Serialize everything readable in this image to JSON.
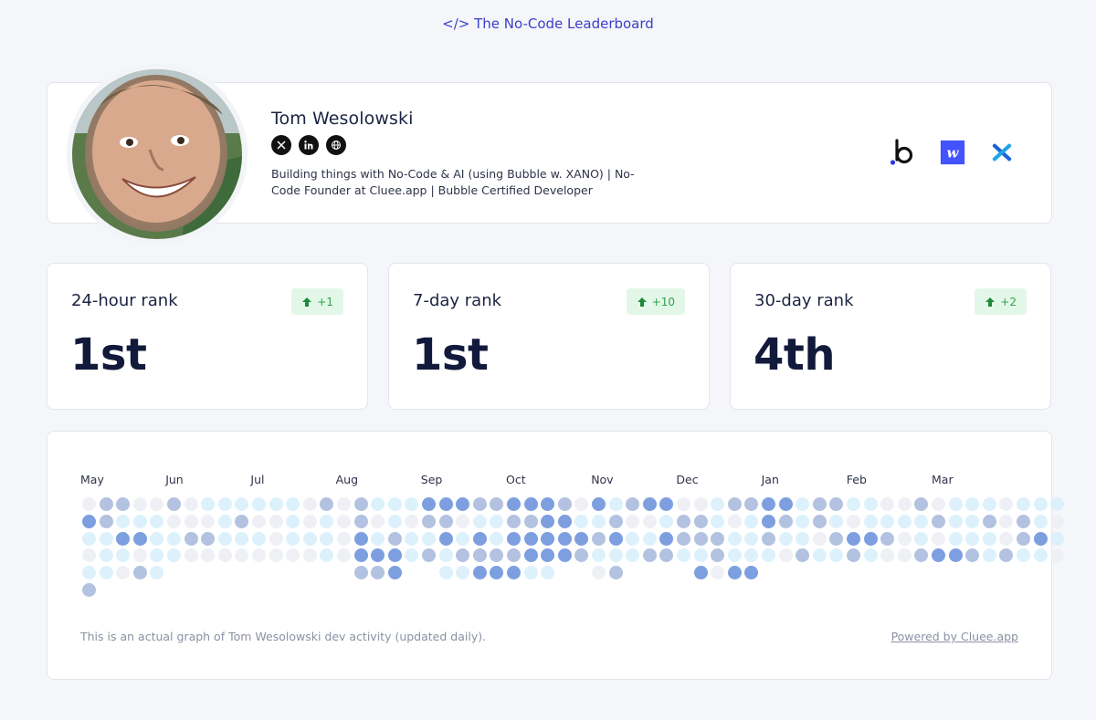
{
  "header": {
    "link_text": "</> The No-Code Leaderboard"
  },
  "profile": {
    "name": "Tom Wesolowski",
    "bio": "Building things with No-Code & AI (using Bubble w. XANO) | No-Code Founder at Cluee.app | Bubble Certified Developer",
    "socials": [
      "x-icon",
      "linkedin-icon",
      "globe-icon"
    ],
    "tools": [
      "bubble-logo",
      "webflow-logo",
      "xano-logo"
    ]
  },
  "ranks": [
    {
      "label": "24-hour rank",
      "change": "+1",
      "value": "1st"
    },
    {
      "label": "7-day rank",
      "change": "+10",
      "value": "1st"
    },
    {
      "label": "30-day rank",
      "change": "+2",
      "value": "4th"
    }
  ],
  "activity": {
    "months": [
      "May",
      "Jun",
      "Jul",
      "Aug",
      "Sep",
      "Oct",
      "Nov",
      "Dec",
      "Jan",
      "Feb",
      "Mar"
    ],
    "levels_colors": [
      "#eef0f5",
      "#dcf1fb",
      "#b3c2e0",
      "#7d9fe0"
    ],
    "weeks": [
      [
        0,
        3,
        1,
        0,
        1,
        2
      ],
      [
        2,
        2,
        1,
        1,
        1
      ],
      [
        2,
        1,
        3,
        1,
        0
      ],
      [
        0,
        1,
        3,
        0,
        2
      ],
      [
        0,
        1,
        1,
        1,
        1
      ],
      [
        2,
        0,
        1,
        1
      ],
      [
        0,
        0,
        2,
        0
      ],
      [
        1,
        0,
        2,
        0
      ],
      [
        1,
        1,
        1,
        0
      ],
      [
        1,
        2,
        1,
        0
      ],
      [
        1,
        0,
        1,
        0
      ],
      [
        1,
        0,
        0,
        0
      ],
      [
        1,
        1,
        1,
        0
      ],
      [
        0,
        0,
        1,
        0
      ],
      [
        2,
        1,
        1,
        1
      ],
      [
        0,
        0,
        0,
        0
      ],
      [
        2,
        2,
        3,
        3,
        2
      ],
      [
        1,
        0,
        1,
        3,
        2
      ],
      [
        1,
        1,
        2,
        3,
        3
      ],
      [
        1,
        0,
        1,
        1
      ],
      [
        3,
        2,
        1,
        2
      ],
      [
        3,
        2,
        3,
        1,
        1
      ],
      [
        3,
        0,
        1,
        2,
        1
      ],
      [
        2,
        1,
        3,
        2,
        3
      ],
      [
        2,
        1,
        1,
        2,
        3
      ],
      [
        3,
        2,
        3,
        2,
        3
      ],
      [
        3,
        2,
        3,
        3,
        1
      ],
      [
        3,
        3,
        3,
        3,
        1
      ],
      [
        2,
        3,
        3,
        3
      ],
      [
        0,
        1,
        3,
        2
      ],
      [
        3,
        1,
        2,
        1,
        0
      ],
      [
        1,
        2,
        3,
        1,
        2
      ],
      [
        2,
        0,
        1,
        1
      ],
      [
        3,
        0,
        1,
        2
      ],
      [
        3,
        1,
        3,
        2
      ],
      [
        0,
        2,
        2,
        1
      ],
      [
        0,
        2,
        2,
        1,
        3
      ],
      [
        1,
        1,
        2,
        2,
        0
      ],
      [
        2,
        0,
        1,
        1,
        3
      ],
      [
        2,
        1,
        1,
        1,
        3
      ],
      [
        3,
        3,
        2,
        1
      ],
      [
        3,
        2,
        1,
        0
      ],
      [
        1,
        1,
        1,
        2
      ],
      [
        2,
        2,
        0,
        1
      ],
      [
        2,
        1,
        2,
        1
      ],
      [
        1,
        0,
        3,
        2
      ],
      [
        1,
        1,
        3,
        1
      ],
      [
        0,
        1,
        2,
        0
      ],
      [
        0,
        1,
        0,
        0
      ],
      [
        2,
        1,
        1,
        2
      ],
      [
        0,
        2,
        0,
        3
      ],
      [
        1,
        1,
        1,
        3
      ],
      [
        1,
        1,
        1,
        2
      ],
      [
        1,
        2,
        1,
        1
      ],
      [
        0,
        0,
        0,
        2
      ],
      [
        1,
        2,
        2,
        1
      ],
      [
        1,
        1,
        3,
        1
      ],
      [
        1,
        0,
        1,
        0
      ]
    ]
  },
  "footer": {
    "note": "This is an actual graph of Tom Wesolowski dev activity (updated daily).",
    "powered": "Powered by Cluee.app"
  }
}
